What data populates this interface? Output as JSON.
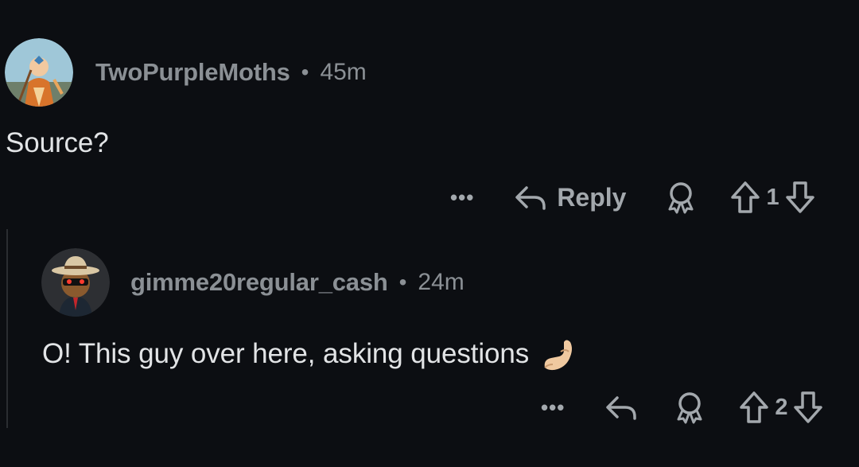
{
  "comments": [
    {
      "username": "TwoPurpleMoths",
      "separator": "•",
      "time": "45m",
      "body": "Source?",
      "more": "•••",
      "reply_label": "Reply",
      "votes": "1"
    },
    {
      "username": "gimme20regular_cash",
      "separator": "•",
      "time": "24m",
      "body": "O! This guy over here, asking questions",
      "more": "•••",
      "votes": "2"
    }
  ],
  "icons": {
    "reply": "reply-arrow-icon",
    "award": "award-icon",
    "upvote": "upvote-arrow-icon",
    "downvote": "downvote-arrow-icon",
    "emoji": "pinched-fingers-emoji"
  },
  "colors": {
    "background": "#0c0e12",
    "meta_text": "#8b9095",
    "body_text": "#e2e4e6",
    "action_icons": "#a3a8ad",
    "thread_line": "#2a2d31"
  }
}
